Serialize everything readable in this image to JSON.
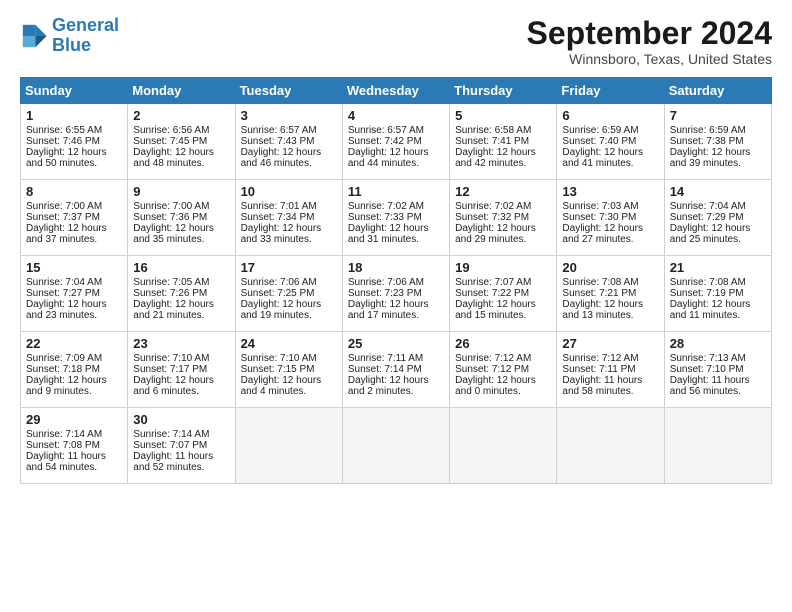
{
  "logo": {
    "line1": "General",
    "line2": "Blue"
  },
  "title": "September 2024",
  "location": "Winnsboro, Texas, United States",
  "days_header": [
    "Sunday",
    "Monday",
    "Tuesday",
    "Wednesday",
    "Thursday",
    "Friday",
    "Saturday"
  ],
  "weeks": [
    [
      {
        "day": "1",
        "lines": [
          "Sunrise: 6:55 AM",
          "Sunset: 7:46 PM",
          "Daylight: 12 hours",
          "and 50 minutes."
        ]
      },
      {
        "day": "2",
        "lines": [
          "Sunrise: 6:56 AM",
          "Sunset: 7:45 PM",
          "Daylight: 12 hours",
          "and 48 minutes."
        ]
      },
      {
        "day": "3",
        "lines": [
          "Sunrise: 6:57 AM",
          "Sunset: 7:43 PM",
          "Daylight: 12 hours",
          "and 46 minutes."
        ]
      },
      {
        "day": "4",
        "lines": [
          "Sunrise: 6:57 AM",
          "Sunset: 7:42 PM",
          "Daylight: 12 hours",
          "and 44 minutes."
        ]
      },
      {
        "day": "5",
        "lines": [
          "Sunrise: 6:58 AM",
          "Sunset: 7:41 PM",
          "Daylight: 12 hours",
          "and 42 minutes."
        ]
      },
      {
        "day": "6",
        "lines": [
          "Sunrise: 6:59 AM",
          "Sunset: 7:40 PM",
          "Daylight: 12 hours",
          "and 41 minutes."
        ]
      },
      {
        "day": "7",
        "lines": [
          "Sunrise: 6:59 AM",
          "Sunset: 7:38 PM",
          "Daylight: 12 hours",
          "and 39 minutes."
        ]
      }
    ],
    [
      {
        "day": "8",
        "lines": [
          "Sunrise: 7:00 AM",
          "Sunset: 7:37 PM",
          "Daylight: 12 hours",
          "and 37 minutes."
        ]
      },
      {
        "day": "9",
        "lines": [
          "Sunrise: 7:00 AM",
          "Sunset: 7:36 PM",
          "Daylight: 12 hours",
          "and 35 minutes."
        ]
      },
      {
        "day": "10",
        "lines": [
          "Sunrise: 7:01 AM",
          "Sunset: 7:34 PM",
          "Daylight: 12 hours",
          "and 33 minutes."
        ]
      },
      {
        "day": "11",
        "lines": [
          "Sunrise: 7:02 AM",
          "Sunset: 7:33 PM",
          "Daylight: 12 hours",
          "and 31 minutes."
        ]
      },
      {
        "day": "12",
        "lines": [
          "Sunrise: 7:02 AM",
          "Sunset: 7:32 PM",
          "Daylight: 12 hours",
          "and 29 minutes."
        ]
      },
      {
        "day": "13",
        "lines": [
          "Sunrise: 7:03 AM",
          "Sunset: 7:30 PM",
          "Daylight: 12 hours",
          "and 27 minutes."
        ]
      },
      {
        "day": "14",
        "lines": [
          "Sunrise: 7:04 AM",
          "Sunset: 7:29 PM",
          "Daylight: 12 hours",
          "and 25 minutes."
        ]
      }
    ],
    [
      {
        "day": "15",
        "lines": [
          "Sunrise: 7:04 AM",
          "Sunset: 7:27 PM",
          "Daylight: 12 hours",
          "and 23 minutes."
        ]
      },
      {
        "day": "16",
        "lines": [
          "Sunrise: 7:05 AM",
          "Sunset: 7:26 PM",
          "Daylight: 12 hours",
          "and 21 minutes."
        ]
      },
      {
        "day": "17",
        "lines": [
          "Sunrise: 7:06 AM",
          "Sunset: 7:25 PM",
          "Daylight: 12 hours",
          "and 19 minutes."
        ]
      },
      {
        "day": "18",
        "lines": [
          "Sunrise: 7:06 AM",
          "Sunset: 7:23 PM",
          "Daylight: 12 hours",
          "and 17 minutes."
        ]
      },
      {
        "day": "19",
        "lines": [
          "Sunrise: 7:07 AM",
          "Sunset: 7:22 PM",
          "Daylight: 12 hours",
          "and 15 minutes."
        ]
      },
      {
        "day": "20",
        "lines": [
          "Sunrise: 7:08 AM",
          "Sunset: 7:21 PM",
          "Daylight: 12 hours",
          "and 13 minutes."
        ]
      },
      {
        "day": "21",
        "lines": [
          "Sunrise: 7:08 AM",
          "Sunset: 7:19 PM",
          "Daylight: 12 hours",
          "and 11 minutes."
        ]
      }
    ],
    [
      {
        "day": "22",
        "lines": [
          "Sunrise: 7:09 AM",
          "Sunset: 7:18 PM",
          "Daylight: 12 hours",
          "and 9 minutes."
        ]
      },
      {
        "day": "23",
        "lines": [
          "Sunrise: 7:10 AM",
          "Sunset: 7:17 PM",
          "Daylight: 12 hours",
          "and 6 minutes."
        ]
      },
      {
        "day": "24",
        "lines": [
          "Sunrise: 7:10 AM",
          "Sunset: 7:15 PM",
          "Daylight: 12 hours",
          "and 4 minutes."
        ]
      },
      {
        "day": "25",
        "lines": [
          "Sunrise: 7:11 AM",
          "Sunset: 7:14 PM",
          "Daylight: 12 hours",
          "and 2 minutes."
        ]
      },
      {
        "day": "26",
        "lines": [
          "Sunrise: 7:12 AM",
          "Sunset: 7:12 PM",
          "Daylight: 12 hours",
          "and 0 minutes."
        ]
      },
      {
        "day": "27",
        "lines": [
          "Sunrise: 7:12 AM",
          "Sunset: 7:11 PM",
          "Daylight: 11 hours",
          "and 58 minutes."
        ]
      },
      {
        "day": "28",
        "lines": [
          "Sunrise: 7:13 AM",
          "Sunset: 7:10 PM",
          "Daylight: 11 hours",
          "and 56 minutes."
        ]
      }
    ],
    [
      {
        "day": "29",
        "lines": [
          "Sunrise: 7:14 AM",
          "Sunset: 7:08 PM",
          "Daylight: 11 hours",
          "and 54 minutes."
        ]
      },
      {
        "day": "30",
        "lines": [
          "Sunrise: 7:14 AM",
          "Sunset: 7:07 PM",
          "Daylight: 11 hours",
          "and 52 minutes."
        ]
      },
      null,
      null,
      null,
      null,
      null
    ]
  ]
}
